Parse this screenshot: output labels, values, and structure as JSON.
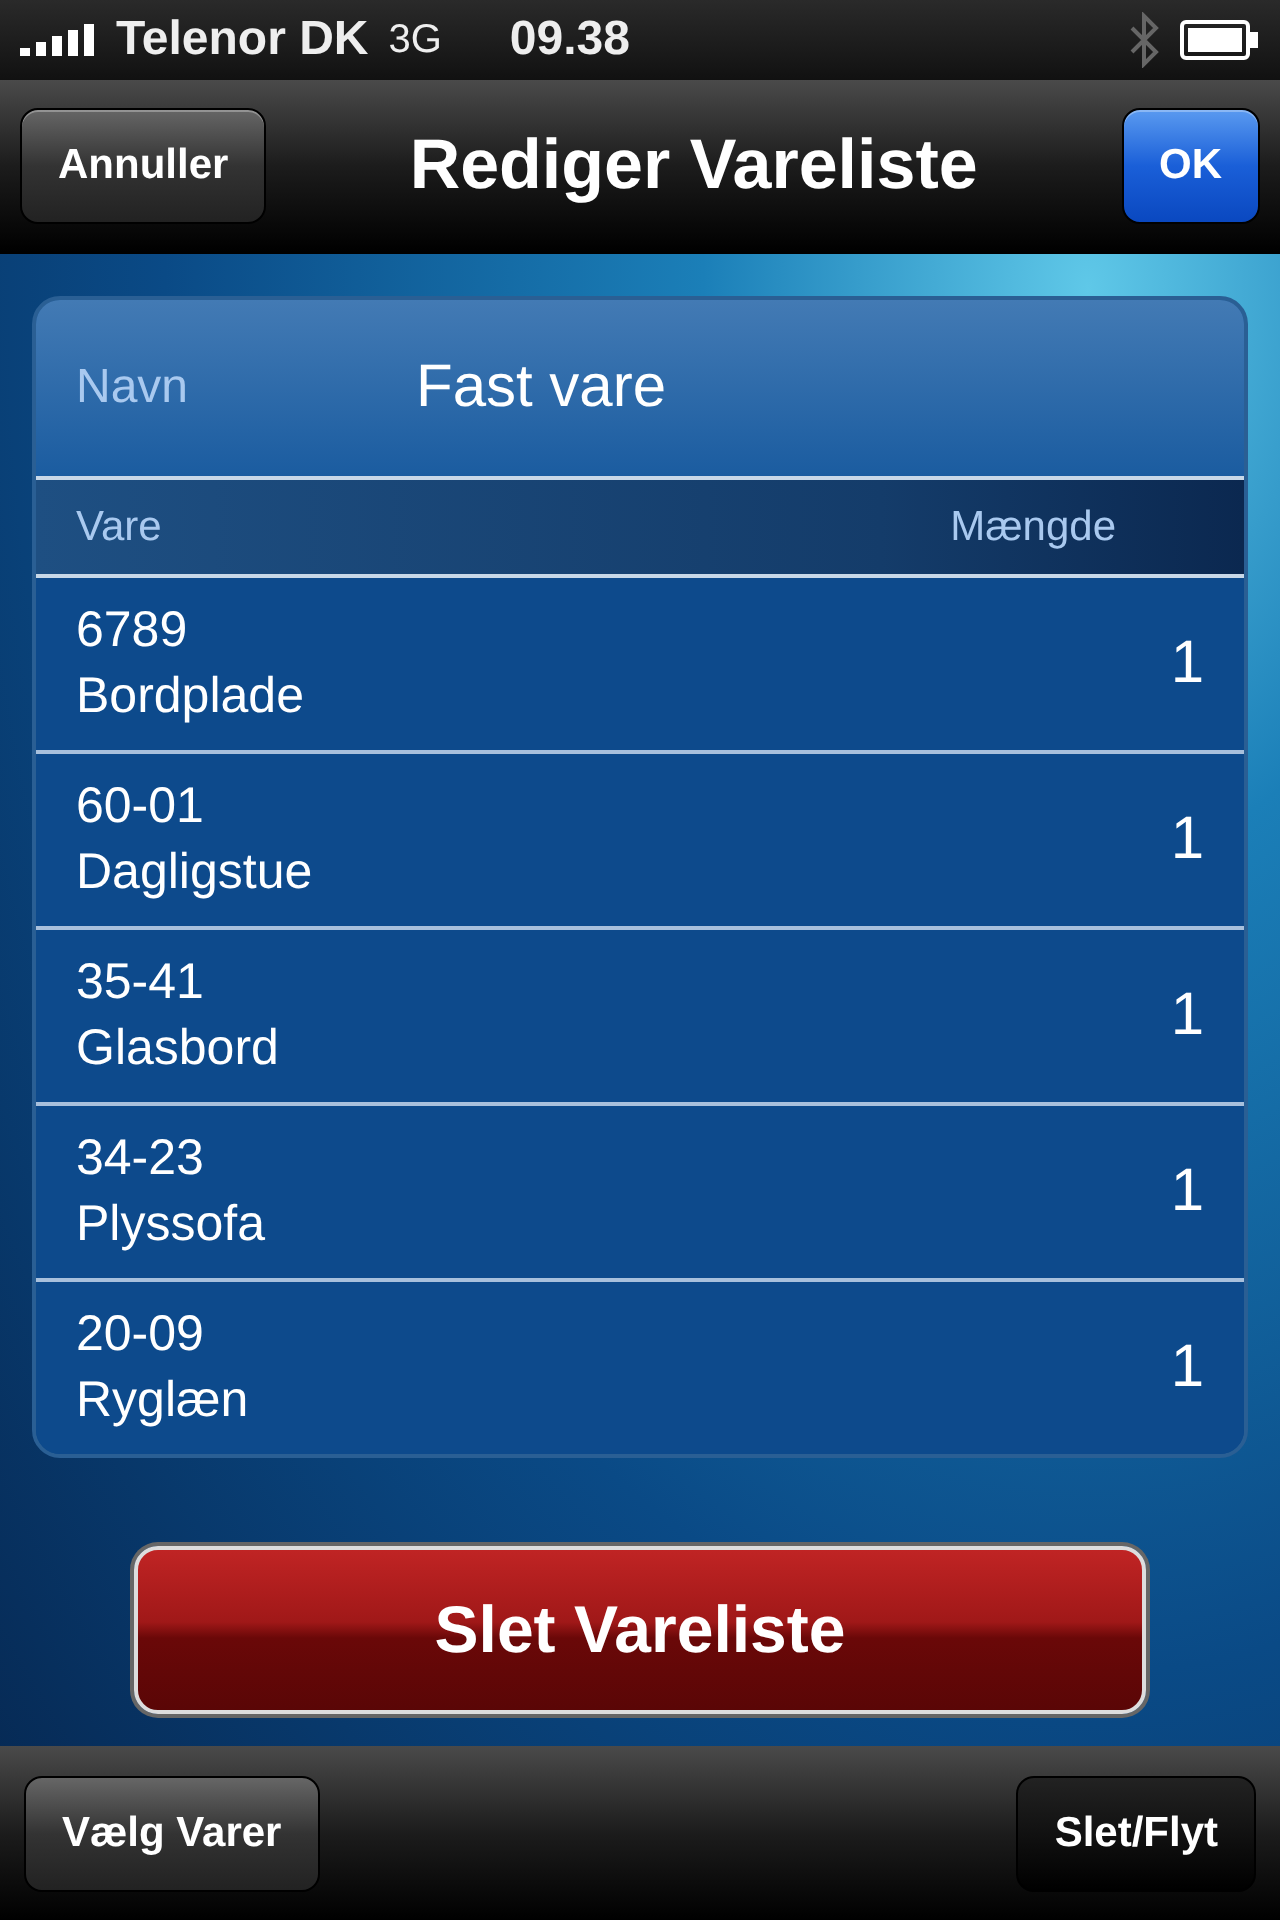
{
  "status_bar": {
    "carrier": "Telenor DK",
    "network": "3G",
    "time": "09.38"
  },
  "nav": {
    "cancel": "Annuller",
    "title": "Rediger Vareliste",
    "ok": "OK"
  },
  "name_field": {
    "label": "Navn",
    "value": "Fast vare"
  },
  "table": {
    "columns": [
      "Vare",
      "Mængde"
    ],
    "rows": [
      {
        "number": "6789",
        "name": "Bordplade",
        "quantity": "1"
      },
      {
        "number": "60-01",
        "name": "Dagligstue",
        "quantity": "1"
      },
      {
        "number": "35-41",
        "name": "Glasbord",
        "quantity": "1"
      },
      {
        "number": "34-23",
        "name": "Plyssofa",
        "quantity": "1"
      },
      {
        "number": "20-09",
        "name": "Ryglæn",
        "quantity": "1"
      }
    ]
  },
  "delete_button": "Slet Vareliste",
  "toolbar": [
    {
      "label": "Vælg Varer",
      "selected": false
    },
    {
      "label": "Slet/Flyt",
      "selected": true
    }
  ]
}
